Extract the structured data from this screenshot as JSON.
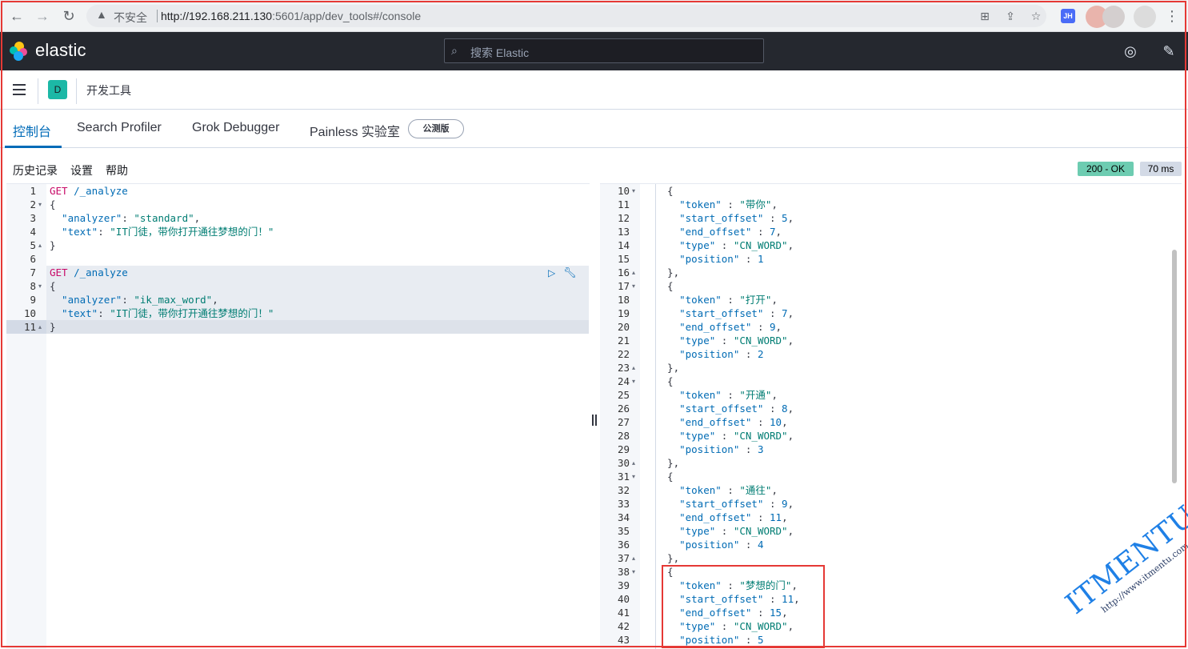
{
  "browser": {
    "insecure_label": "不安全",
    "url_host": "http://192.168.211.130",
    "url_rest": ":5601/app/dev_tools#/console",
    "profile_badge": "JH"
  },
  "header": {
    "brand": "elastic",
    "search_placeholder": "搜索 Elastic"
  },
  "breadcrumb": {
    "space_initial": "D",
    "title": "开发工具"
  },
  "tabs": [
    {
      "label": "控制台",
      "active": true
    },
    {
      "label": "Search Profiler"
    },
    {
      "label": "Grok Debugger"
    },
    {
      "label": "Painless 实验室"
    }
  ],
  "beta_badge": "公测版",
  "console_menu": [
    "历史记录",
    "设置",
    "帮助"
  ],
  "response_status": {
    "code": "200 - OK",
    "time": "70 ms"
  },
  "request_lines": [
    {
      "n": "1",
      "method": "GET",
      "path": " /_analyze"
    },
    {
      "n": "2",
      "text": "{"
    },
    {
      "n": "3",
      "key": "  \"analyzer\"",
      "sep": ": ",
      "val": "\"standard\"",
      "end": ","
    },
    {
      "n": "4",
      "key": "  \"text\"",
      "sep": ": ",
      "val": "\"IT门徒，带你打开通往梦想的门！\"",
      "end": ""
    },
    {
      "n": "5",
      "text": "}"
    },
    {
      "n": "6",
      "text": ""
    },
    {
      "n": "7",
      "method": "GET",
      "path": " /_analyze"
    },
    {
      "n": "8",
      "text": "{"
    },
    {
      "n": "9",
      "key": "  \"analyzer\"",
      "sep": ": ",
      "val": "\"ik_max_word\"",
      "end": ","
    },
    {
      "n": "10",
      "key": "  \"text\"",
      "sep": ": ",
      "val": "\"IT门徒，带你打开通往梦想的门！\"",
      "end": ""
    },
    {
      "n": "11",
      "text": "}"
    }
  ],
  "response_lines": [
    {
      "n": "10",
      "text": "  {"
    },
    {
      "n": "11",
      "key": "    \"token\"",
      "val": "\"带你\"",
      "end": ","
    },
    {
      "n": "12",
      "key": "    \"start_offset\"",
      "num": "5",
      "end": ","
    },
    {
      "n": "13",
      "key": "    \"end_offset\"",
      "num": "7",
      "end": ","
    },
    {
      "n": "14",
      "key": "    \"type\"",
      "val": "\"CN_WORD\"",
      "end": ","
    },
    {
      "n": "15",
      "key": "    \"position\"",
      "num": "1",
      "end": ""
    },
    {
      "n": "16",
      "text": "  },"
    },
    {
      "n": "17",
      "text": "  {"
    },
    {
      "n": "18",
      "key": "    \"token\"",
      "val": "\"打开\"",
      "end": ","
    },
    {
      "n": "19",
      "key": "    \"start_offset\"",
      "num": "7",
      "end": ","
    },
    {
      "n": "20",
      "key": "    \"end_offset\"",
      "num": "9",
      "end": ","
    },
    {
      "n": "21",
      "key": "    \"type\"",
      "val": "\"CN_WORD\"",
      "end": ","
    },
    {
      "n": "22",
      "key": "    \"position\"",
      "num": "2",
      "end": ""
    },
    {
      "n": "23",
      "text": "  },"
    },
    {
      "n": "24",
      "text": "  {"
    },
    {
      "n": "25",
      "key": "    \"token\"",
      "val": "\"开通\"",
      "end": ","
    },
    {
      "n": "26",
      "key": "    \"start_offset\"",
      "num": "8",
      "end": ","
    },
    {
      "n": "27",
      "key": "    \"end_offset\"",
      "num": "10",
      "end": ","
    },
    {
      "n": "28",
      "key": "    \"type\"",
      "val": "\"CN_WORD\"",
      "end": ","
    },
    {
      "n": "29",
      "key": "    \"position\"",
      "num": "3",
      "end": ""
    },
    {
      "n": "30",
      "text": "  },"
    },
    {
      "n": "31",
      "text": "  {"
    },
    {
      "n": "32",
      "key": "    \"token\"",
      "val": "\"通往\"",
      "end": ","
    },
    {
      "n": "33",
      "key": "    \"start_offset\"",
      "num": "9",
      "end": ","
    },
    {
      "n": "34",
      "key": "    \"end_offset\"",
      "num": "11",
      "end": ","
    },
    {
      "n": "35",
      "key": "    \"type\"",
      "val": "\"CN_WORD\"",
      "end": ","
    },
    {
      "n": "36",
      "key": "    \"position\"",
      "num": "4",
      "end": ""
    },
    {
      "n": "37",
      "text": "  },"
    },
    {
      "n": "38",
      "text": "  {"
    },
    {
      "n": "39",
      "key": "    \"token\"",
      "val": "\"梦想的门\"",
      "end": ","
    },
    {
      "n": "40",
      "key": "    \"start_offset\"",
      "num": "11",
      "end": ","
    },
    {
      "n": "41",
      "key": "    \"end_offset\"",
      "num": "15",
      "end": ","
    },
    {
      "n": "42",
      "key": "    \"type\"",
      "val": "\"CN_WORD\"",
      "end": ","
    },
    {
      "n": "43",
      "key": "    \"position\"",
      "num": "5",
      "end": ""
    }
  ],
  "watermark": {
    "title": "ITMENTU",
    "url": "http://www.itmentu.com"
  },
  "colors": {
    "accent": "#006bb8",
    "status_ok": "#6dccb1",
    "header_bg": "#25282f",
    "annotation": "#e53935"
  }
}
